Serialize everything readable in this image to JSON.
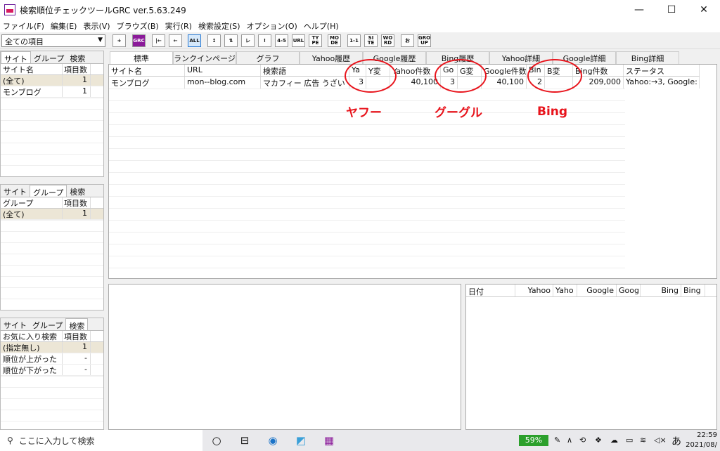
{
  "window": {
    "title": "検索順位チェックツールGRC  ver.5.63.249",
    "minimize": "—",
    "maximize": "☐",
    "close": "✕"
  },
  "menu": [
    "ファイル(F)",
    "編集(E)",
    "表示(V)",
    "ブラウズ(B)",
    "実行(R)",
    "検索設定(S)",
    "オプション(O)",
    "ヘルプ(H)"
  ],
  "toolbar": {
    "filter_value": "全ての項目",
    "buttons": [
      "+",
      "GRC",
      "|←",
      "←",
      "ALL",
      "↥",
      "⇅",
      "レ",
      "!",
      "4-5",
      "URL",
      "TY PE",
      "MO DE",
      "1-1",
      "SI TE",
      "WO RD",
      "お",
      "GRO UP"
    ]
  },
  "site_panel": {
    "tabs": [
      "サイト",
      "グループ",
      "検索"
    ],
    "col_name": "サイト名",
    "col_count": "項目数",
    "rows": [
      {
        "name": "(全て)",
        "count": "1"
      },
      {
        "name": "モンブログ",
        "count": "1"
      }
    ]
  },
  "group_panel": {
    "tabs": [
      "サイト",
      "グループ",
      "検索"
    ],
    "col_name": "グループ",
    "col_count": "項目数",
    "rows": [
      {
        "name": "(全て)",
        "count": "1"
      }
    ]
  },
  "search_panel": {
    "tabs": [
      "サイト",
      "グループ",
      "検索"
    ],
    "col_name": "お気に入り検索",
    "col_count": "項目数",
    "rows": [
      {
        "name": "(指定無し)",
        "count": "1"
      },
      {
        "name": "順位が上がった",
        "count": "-"
      },
      {
        "name": "順位が下がった",
        "count": "-"
      }
    ]
  },
  "main_tabs": [
    "標準",
    "ランクインページ",
    "グラフ",
    "Yahoo履歴",
    "Google履歴",
    "Bing履歴",
    "Yahoo詳細",
    "Google詳細",
    "Bing詳細"
  ],
  "grid": {
    "headers": [
      "サイト名",
      "URL",
      "検索語",
      "Ya",
      "Y変",
      "Yahoo件数",
      "Go",
      "G変",
      "Google件数",
      "Bin",
      "B変",
      "Bing件数",
      "ステータス"
    ],
    "rows": [
      [
        "モンブログ",
        "mon--blog.com",
        "マカフィー 広告 うざい",
        "3",
        "",
        "40,100",
        "3",
        "",
        "40,100",
        "2",
        "",
        "209,000",
        "Yahoo:→3, Google:"
      ]
    ]
  },
  "annotations": {
    "yahoo": "ヤフー",
    "google": "グーグル",
    "bing": "Bing",
    "color": "#e8141c"
  },
  "history_headers": [
    "日付",
    "Yahoo",
    "Yaho",
    "Google",
    "Goog",
    "Bing",
    "Bing"
  ],
  "taskbar": {
    "search_placeholder": "ここに入力して検索",
    "battery": "59%",
    "ime": "あ",
    "time": "22:59",
    "date": "2021/08/"
  }
}
